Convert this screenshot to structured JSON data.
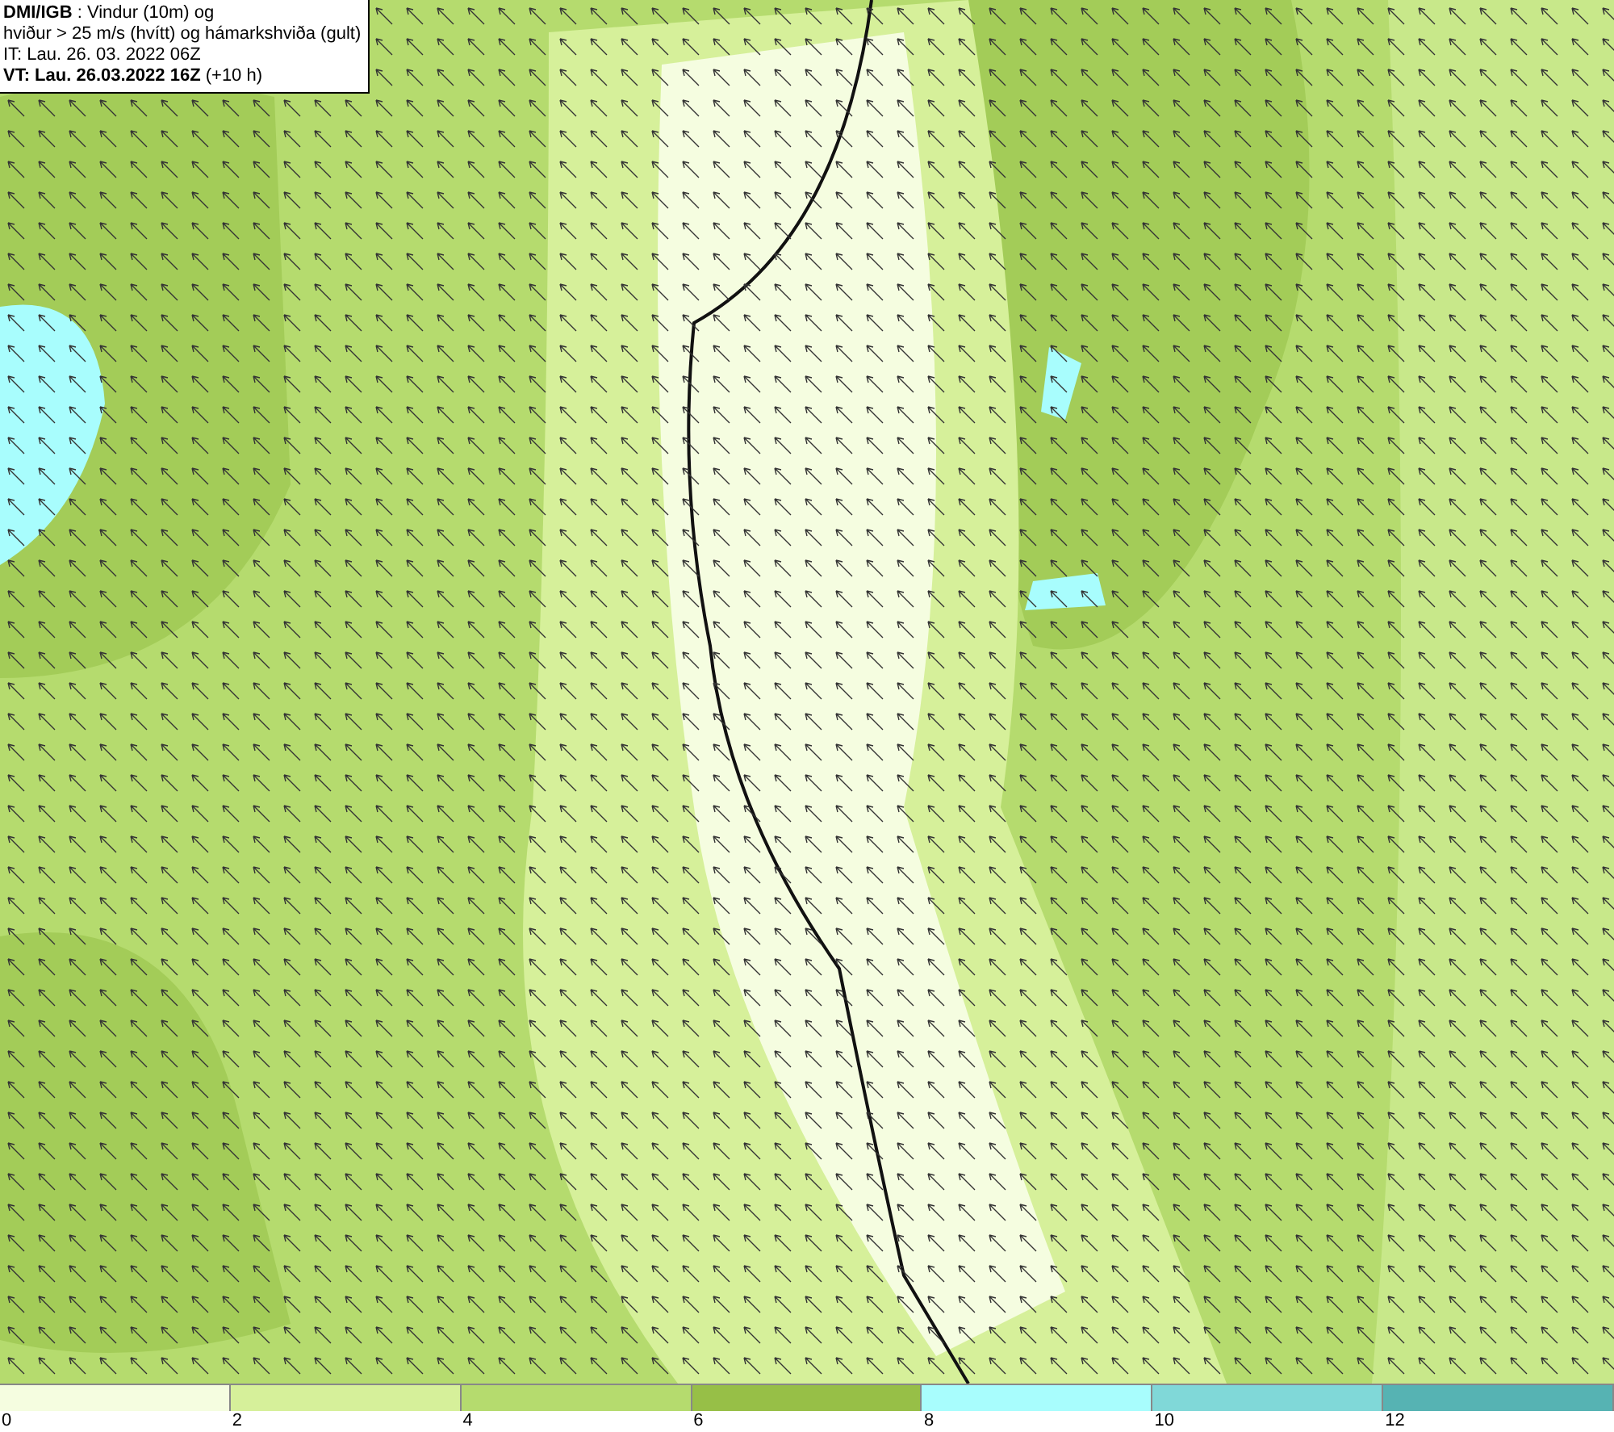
{
  "header": {
    "lines": [
      "**DMI/IGB** : Vindur (10m) og",
      "hviður > 25 m/s (hvítt) og hámarkshviða (gult)",
      "IT: Lau. 26. 03. 2022 06Z",
      "**VT: Lau. 26.03.2022 16Z** (+10 h)"
    ]
  },
  "legend": {
    "bins": [
      {
        "color": "#f5fde0"
      },
      {
        "color": "#d6f09a"
      },
      {
        "color": "#b5db6e"
      },
      {
        "color": "#97bf47"
      },
      {
        "color": "#a8fdfd"
      },
      {
        "color": "#80d8d8"
      },
      {
        "color": "#56b3b3"
      }
    ],
    "labels": [
      "0",
      "2",
      "4",
      "6",
      "8",
      "10",
      "12"
    ]
  }
}
